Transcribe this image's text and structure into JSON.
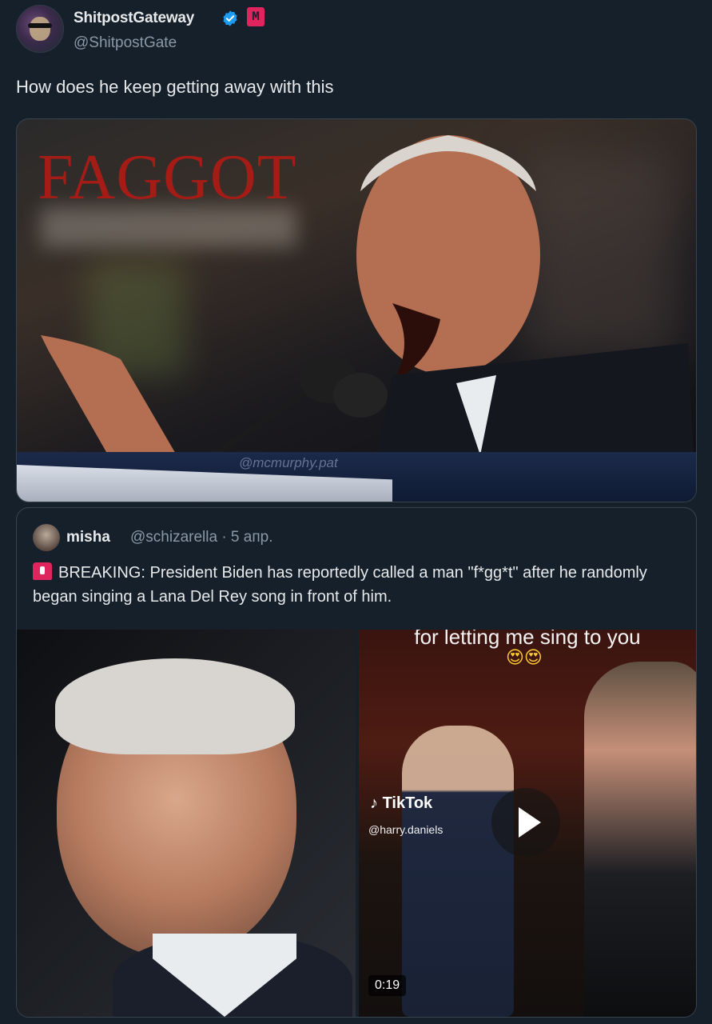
{
  "author": {
    "display_name": "ShitpostGateway",
    "handle": "@ShitpostGate",
    "badge_letter": "M"
  },
  "tweet": {
    "text": "How does he keep getting away with this"
  },
  "main_media": {
    "overlay_text": "FAGGOT",
    "watermark": "@mcmurphy.pat"
  },
  "quote": {
    "display_name": "misha",
    "handle_date": "@schizarella · 5 апр.",
    "text": "BREAKING: President Biden has reportedly called a man \"f*gg*t\" after he randomly began singing a Lana Del Rey song in front of him.",
    "video": {
      "caption": "for letting me sing to you",
      "emoji": "😍😍",
      "brand": "TikTok",
      "user": "@harry.daniels",
      "duration": "0:19"
    }
  },
  "colors": {
    "background": "#15202b",
    "text_primary": "#e7e9ea",
    "text_secondary": "#8b98a5",
    "verified_blue": "#1d9bf0",
    "border": "#38444d"
  }
}
